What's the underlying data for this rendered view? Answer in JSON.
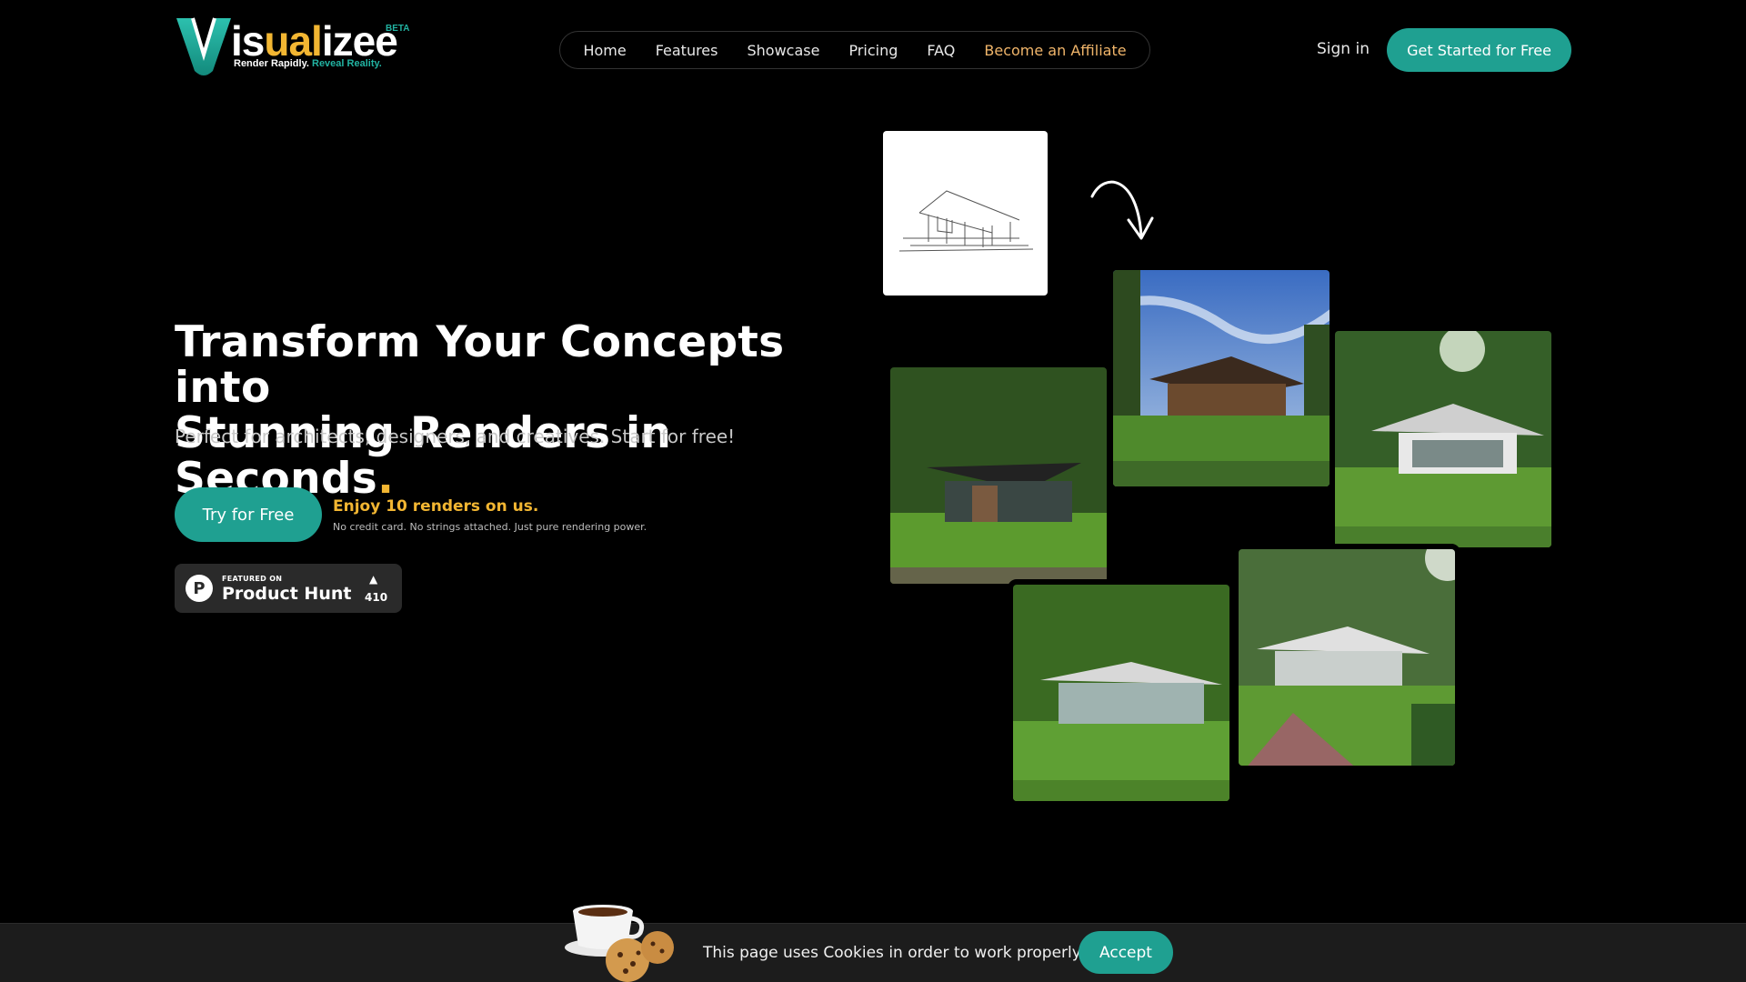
{
  "brand": {
    "v_letter": "V",
    "word_start": "is",
    "word_mid": "ual",
    "word_end": "izee",
    "beta": "BETA",
    "tag_part1": "Render Rapidly.",
    "tag_part2": "Reveal Reality.",
    "primary_color": "#1fa091",
    "accent_color": "#f2b632"
  },
  "nav": {
    "items": [
      "Home",
      "Features",
      "Showcase",
      "Pricing",
      "FAQ"
    ],
    "affiliate": "Become an Affiliate"
  },
  "header": {
    "sign_in": "Sign in",
    "cta": "Get Started for Free"
  },
  "hero": {
    "title_line1": "Transform Your Concepts into",
    "title_line2": "Stunning Renders in Seconds",
    "title_dot": ".",
    "subtitle": "Perfect for architects, designers, and creatives. Start for free!",
    "try_button": "Try for Free",
    "offer_title": "Enjoy 10 renders on us.",
    "offer_sub": "No credit card. No strings attached. Just pure rendering power."
  },
  "product_hunt": {
    "logo_letter": "P",
    "featured": "FEATURED ON",
    "name": "Product Hunt",
    "upvote_glyph": "▲",
    "count": "410"
  },
  "showcase": {
    "sketch_icon": "sketch-house-icon",
    "arrow_icon": "curved-arrow-icon"
  },
  "cookies": {
    "text": "This page uses Cookies in order to work properly.",
    "accept": "Accept",
    "icon": "coffee-cookies-icon"
  }
}
